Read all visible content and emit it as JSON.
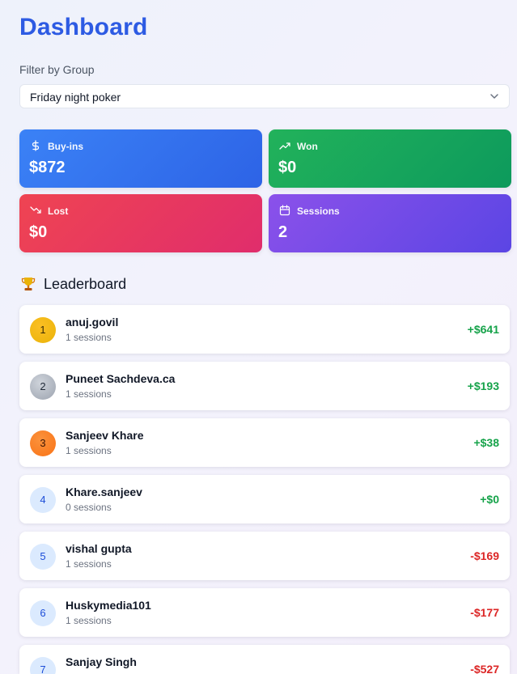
{
  "header": {
    "title": "Dashboard"
  },
  "filter": {
    "label": "Filter by Group",
    "selected": "Friday night poker",
    "icon": "chevron-down-icon"
  },
  "stats": {
    "buyins": {
      "label": "Buy-ins",
      "value": "$872",
      "icon": "dollar-icon",
      "color": "#3b82f6"
    },
    "won": {
      "label": "Won",
      "value": "$0",
      "icon": "trending-up-icon",
      "color": "#16a34a"
    },
    "lost": {
      "label": "Lost",
      "value": "$0",
      "icon": "trending-down-icon",
      "color": "#ef4444"
    },
    "sessions": {
      "label": "Sessions",
      "value": "2",
      "icon": "calendar-icon",
      "color": "#7c3aed"
    }
  },
  "leaderboard": {
    "title": "Leaderboard",
    "icon": "trophy-icon",
    "players": [
      {
        "rank": "1",
        "name": "anuj.govil",
        "sessions": "1 sessions",
        "amount": "+$641"
      },
      {
        "rank": "2",
        "name": "Puneet Sachdeva.ca",
        "sessions": "1 sessions",
        "amount": "+$193"
      },
      {
        "rank": "3",
        "name": "Sanjeev Khare",
        "sessions": "1 sessions",
        "amount": "+$38"
      },
      {
        "rank": "4",
        "name": "Khare.sanjeev",
        "sessions": "0 sessions",
        "amount": "+$0"
      },
      {
        "rank": "5",
        "name": "vishal gupta",
        "sessions": "1 sessions",
        "amount": "-$169"
      },
      {
        "rank": "6",
        "name": "Huskymedia101",
        "sessions": "1 sessions",
        "amount": "-$177"
      },
      {
        "rank": "7",
        "name": "Sanjay Singh",
        "amount": "-$527"
      }
    ]
  }
}
